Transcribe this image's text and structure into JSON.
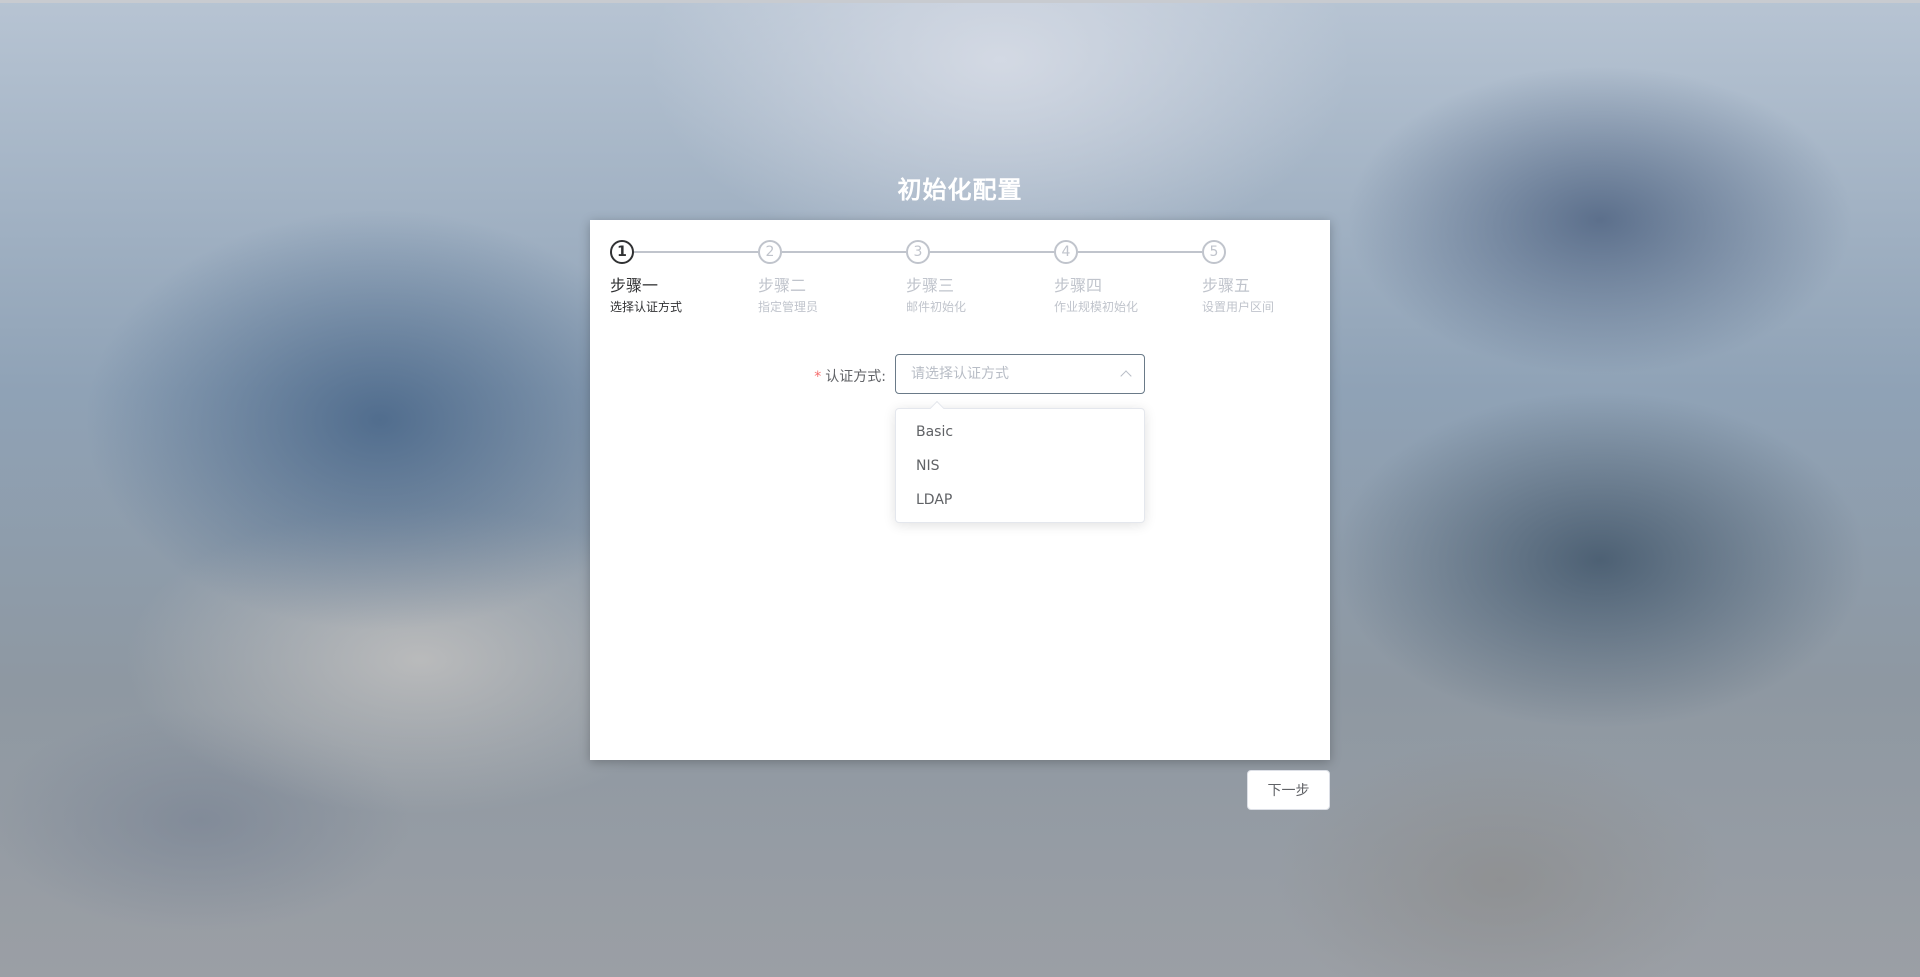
{
  "page": {
    "title": "初始化配置"
  },
  "steps": [
    {
      "number": "1",
      "title": "步骤一",
      "description": "选择认证方式",
      "active": true
    },
    {
      "number": "2",
      "title": "步骤二",
      "description": "指定管理员",
      "active": false
    },
    {
      "number": "3",
      "title": "步骤三",
      "description": "邮件初始化",
      "active": false
    },
    {
      "number": "4",
      "title": "步骤四",
      "description": "作业规模初始化",
      "active": false
    },
    {
      "number": "5",
      "title": "步骤五",
      "description": "设置用户区间",
      "active": false
    }
  ],
  "form": {
    "auth_label": "认证方式:",
    "required_mark": "*",
    "auth_placeholder": "请选择认证方式",
    "auth_value": "",
    "dropdown_open": true,
    "options": [
      "Basic",
      "NIS",
      "LDAP"
    ]
  },
  "actions": {
    "next_label": "下一步"
  },
  "colors": {
    "required": "#f56c6c",
    "active_step": "#303133",
    "inactive_step": "#c0c4cc"
  },
  "icons": {
    "select_arrow": "chevron-up-icon"
  }
}
